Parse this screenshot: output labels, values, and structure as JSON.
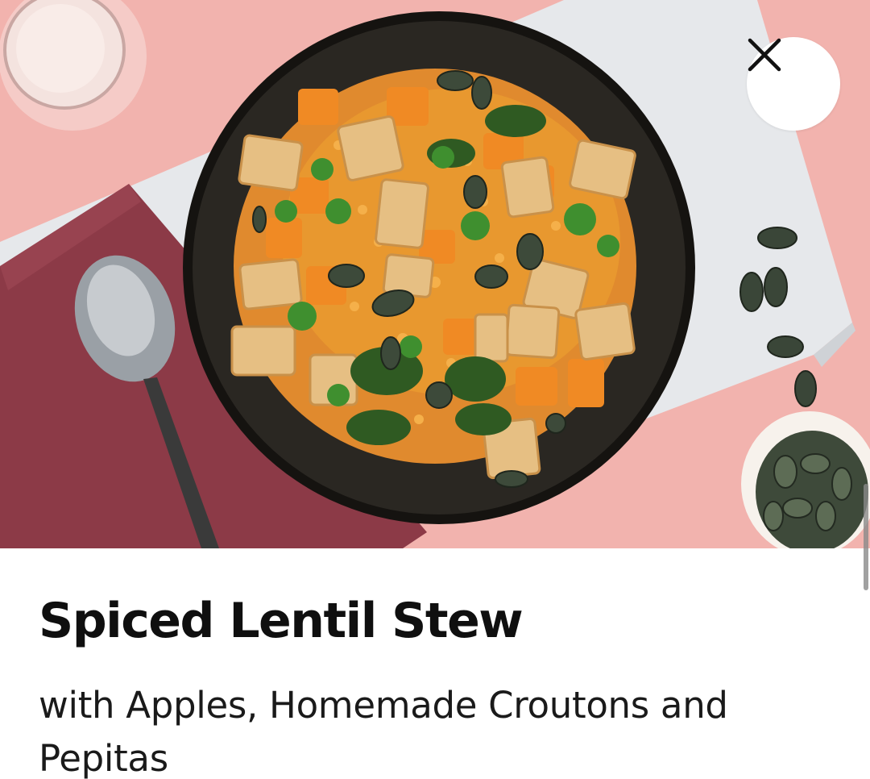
{
  "recipe": {
    "title": "Spiced Lentil Stew",
    "subtitle": "with Apples, Homemade Croutons and Pepitas"
  },
  "hero_image": {
    "description_icon": "recipe-photo"
  },
  "close_button": {
    "icon": "close-icon"
  },
  "colors": {
    "background_pink": "#f2b3ae",
    "napkin": "#8e3b48",
    "board": "#e7e9ec",
    "bowl": "#1c1a17",
    "stew": "#e08a2e"
  }
}
